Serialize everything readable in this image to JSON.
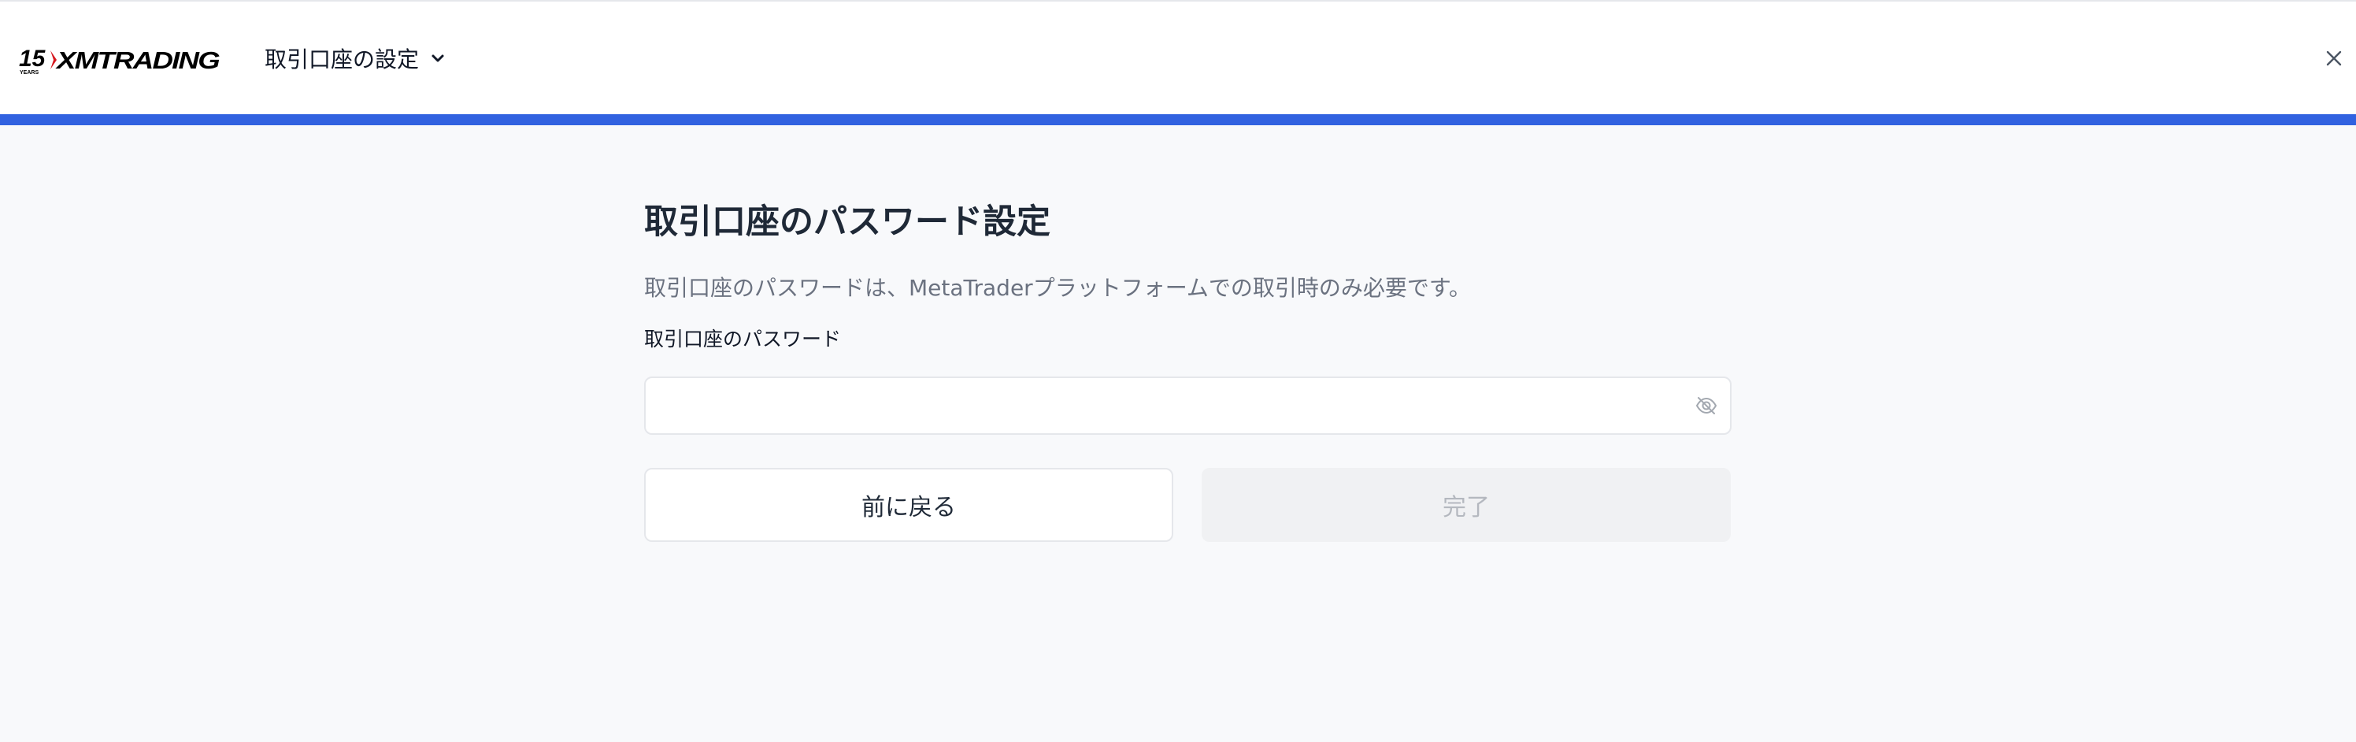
{
  "header": {
    "logo": {
      "years": "15",
      "years_caption": "YEARS",
      "brand": "XMTRADING"
    },
    "flow_title": "取引口座の設定",
    "dropdown_icon": "chevron-down-icon",
    "close_icon": "close-icon"
  },
  "progress": {
    "value_percent": 100,
    "color": "#3162e0"
  },
  "main": {
    "title": "取引口座のパスワード設定",
    "description": "取引口座のパスワードは、MetaTraderプラットフォームでの取引時のみ必要です。",
    "password_field": {
      "label": "取引口座のパスワード",
      "value": "",
      "placeholder": "",
      "toggle_icon": "eye-off-icon"
    },
    "back_button": "前に戻る",
    "done_button": "完了"
  },
  "colors": {
    "accent": "#3162e0",
    "background": "#f8f9fb",
    "disabled_text": "#b4b8bf"
  }
}
